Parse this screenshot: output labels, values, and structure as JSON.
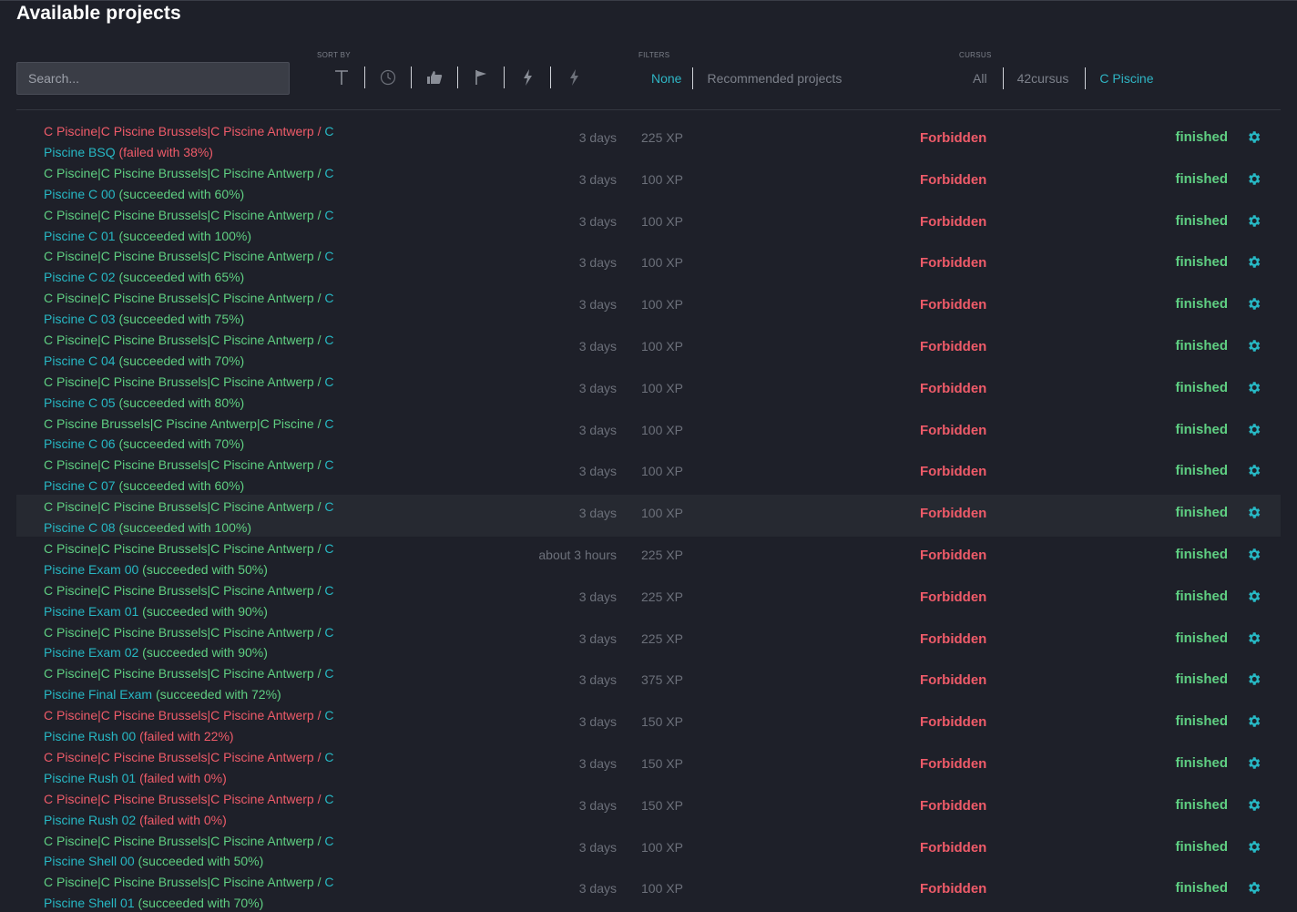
{
  "page": {
    "title": "Available projects"
  },
  "search": {
    "placeholder": "Search..."
  },
  "sort": {
    "label": "SORT BY",
    "icons": [
      "text-icon",
      "clock-icon",
      "thumbs-up-icon",
      "flag-icon",
      "lightning-icon",
      "lightning-outline-icon"
    ]
  },
  "filters": {
    "label": "FILTERS",
    "options": [
      "None",
      "Recommended projects"
    ],
    "selected": "None"
  },
  "cursus": {
    "label": "CURSUS",
    "options": [
      "All",
      "42cursus",
      "C Piscine"
    ],
    "selected": "C Piscine"
  },
  "colors": {
    "failed": "#ef5b69",
    "succeeded": "#5fcf82",
    "link": "#27b8c4",
    "accent": "#2fb5c4"
  },
  "projects": [
    {
      "status": "failed",
      "cursus": "C Piscine|C Piscine Brussels|C Piscine Antwerp",
      "sep": " / ",
      "name": "C Piscine BSQ",
      "result": "(failed with 38%)",
      "duration": "3 days",
      "xp": "225 XP",
      "permission": "Forbidden",
      "state": "finished"
    },
    {
      "status": "succeeded",
      "cursus": "C Piscine|C Piscine Brussels|C Piscine Antwerp",
      "sep": " / ",
      "name": "C Piscine C 00",
      "result": "(succeeded with 60%)",
      "duration": "3 days",
      "xp": "100 XP",
      "permission": "Forbidden",
      "state": "finished"
    },
    {
      "status": "succeeded",
      "cursus": "C Piscine|C Piscine Brussels|C Piscine Antwerp",
      "sep": " / ",
      "name": "C Piscine C 01",
      "result": "(succeeded with 100%)",
      "duration": "3 days",
      "xp": "100 XP",
      "permission": "Forbidden",
      "state": "finished"
    },
    {
      "status": "succeeded",
      "cursus": "C Piscine|C Piscine Brussels|C Piscine Antwerp",
      "sep": " / ",
      "name": "C Piscine C 02",
      "result": "(succeeded with 65%)",
      "duration": "3 days",
      "xp": "100 XP",
      "permission": "Forbidden",
      "state": "finished"
    },
    {
      "status": "succeeded",
      "cursus": "C Piscine|C Piscine Brussels|C Piscine Antwerp",
      "sep": " / ",
      "name": "C Piscine C 03",
      "result": "(succeeded with 75%)",
      "duration": "3 days",
      "xp": "100 XP",
      "permission": "Forbidden",
      "state": "finished"
    },
    {
      "status": "succeeded",
      "cursus": "C Piscine|C Piscine Brussels|C Piscine Antwerp",
      "sep": " / ",
      "name": "C Piscine C 04",
      "result": "(succeeded with 70%)",
      "duration": "3 days",
      "xp": "100 XP",
      "permission": "Forbidden",
      "state": "finished"
    },
    {
      "status": "succeeded",
      "cursus": "C Piscine|C Piscine Brussels|C Piscine Antwerp",
      "sep": " / ",
      "name": "C Piscine C 05",
      "result": "(succeeded with 80%)",
      "duration": "3 days",
      "xp": "100 XP",
      "permission": "Forbidden",
      "state": "finished"
    },
    {
      "status": "succeeded",
      "cursus": "C Piscine Brussels|C Piscine Antwerp|C Piscine",
      "sep": " / ",
      "name": "C Piscine C 06",
      "result": "(succeeded with 70%)",
      "duration": "3 days",
      "xp": "100 XP",
      "permission": "Forbidden",
      "state": "finished"
    },
    {
      "status": "succeeded",
      "cursus": "C Piscine|C Piscine Brussels|C Piscine Antwerp",
      "sep": " / ",
      "name": "C Piscine C 07",
      "result": "(succeeded with 60%)",
      "duration": "3 days",
      "xp": "100 XP",
      "permission": "Forbidden",
      "state": "finished"
    },
    {
      "status": "succeeded",
      "cursus": "C Piscine|C Piscine Brussels|C Piscine Antwerp",
      "sep": " / ",
      "name": "C Piscine C 08",
      "result": "(succeeded with 100%)",
      "duration": "3 days",
      "xp": "100 XP",
      "permission": "Forbidden",
      "state": "finished",
      "highlighted": true
    },
    {
      "status": "succeeded",
      "cursus": "C Piscine|C Piscine Brussels|C Piscine Antwerp",
      "sep": " / ",
      "name": "C Piscine Exam 00",
      "result": "(succeeded with 50%)",
      "duration": "about 3 hours",
      "xp": "225 XP",
      "permission": "Forbidden",
      "state": "finished"
    },
    {
      "status": "succeeded",
      "cursus": "C Piscine|C Piscine Brussels|C Piscine Antwerp",
      "sep": " / ",
      "name": "C Piscine Exam 01",
      "result": "(succeeded with 90%)",
      "duration": "3 days",
      "xp": "225 XP",
      "permission": "Forbidden",
      "state": "finished"
    },
    {
      "status": "succeeded",
      "cursus": "C Piscine|C Piscine Brussels|C Piscine Antwerp",
      "sep": " / ",
      "name": "C Piscine Exam 02",
      "result": "(succeeded with 90%)",
      "duration": "3 days",
      "xp": "225 XP",
      "permission": "Forbidden",
      "state": "finished"
    },
    {
      "status": "succeeded",
      "cursus": "C Piscine|C Piscine Brussels|C Piscine Antwerp",
      "sep": " / ",
      "name": "C Piscine Final Exam",
      "result": "(succeeded with 72%)",
      "duration": "3 days",
      "xp": "375 XP",
      "permission": "Forbidden",
      "state": "finished"
    },
    {
      "status": "failed",
      "cursus": "C Piscine|C Piscine Brussels|C Piscine Antwerp",
      "sep": " / ",
      "name": "C Piscine Rush 00",
      "result": "(failed with 22%)",
      "duration": "3 days",
      "xp": "150 XP",
      "permission": "Forbidden",
      "state": "finished"
    },
    {
      "status": "failed",
      "cursus": "C Piscine|C Piscine Brussels|C Piscine Antwerp",
      "sep": " / ",
      "name": "C Piscine Rush 01",
      "result": "(failed with 0%)",
      "duration": "3 days",
      "xp": "150 XP",
      "permission": "Forbidden",
      "state": "finished"
    },
    {
      "status": "failed",
      "cursus": "C Piscine|C Piscine Brussels|C Piscine Antwerp",
      "sep": " / ",
      "name": "C Piscine Rush 02",
      "result": "(failed with 0%)",
      "duration": "3 days",
      "xp": "150 XP",
      "permission": "Forbidden",
      "state": "finished"
    },
    {
      "status": "succeeded",
      "cursus": "C Piscine|C Piscine Brussels|C Piscine Antwerp",
      "sep": " / ",
      "name": "C Piscine Shell 00",
      "result": "(succeeded with 50%)",
      "duration": "3 days",
      "xp": "100 XP",
      "permission": "Forbidden",
      "state": "finished"
    },
    {
      "status": "succeeded",
      "cursus": "C Piscine|C Piscine Brussels|C Piscine Antwerp",
      "sep": " / ",
      "name": "C Piscine Shell 01",
      "result": "(succeeded with 70%)",
      "duration": "3 days",
      "xp": "100 XP",
      "permission": "Forbidden",
      "state": "finished"
    }
  ]
}
